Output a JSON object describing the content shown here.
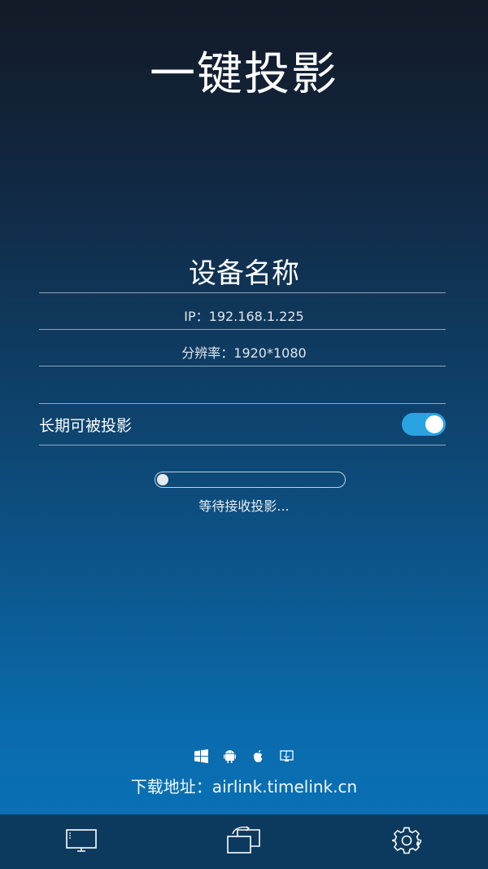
{
  "app": {
    "title": "一键投影"
  },
  "device": {
    "name": "设备名称",
    "ip": "IP：192.168.1.225",
    "resolution": "分辨率：1920*1080"
  },
  "settings": {
    "long_term_label": "长期可被投影",
    "long_term_enabled": true
  },
  "status": {
    "progress": 0,
    "waiting_text": "等待接收投影..."
  },
  "footer": {
    "platforms": [
      "windows-icon",
      "android-icon",
      "apple-icon",
      "mac-finder-icon"
    ],
    "download_text": "下载地址：airlink.timelink.cn"
  },
  "tabbar": {
    "items": [
      "monitor-icon",
      "screen-switch-icon",
      "settings-gear-icon"
    ]
  },
  "colors": {
    "accent": "#2aa3e2",
    "tabbar": "#0c3a5f"
  }
}
